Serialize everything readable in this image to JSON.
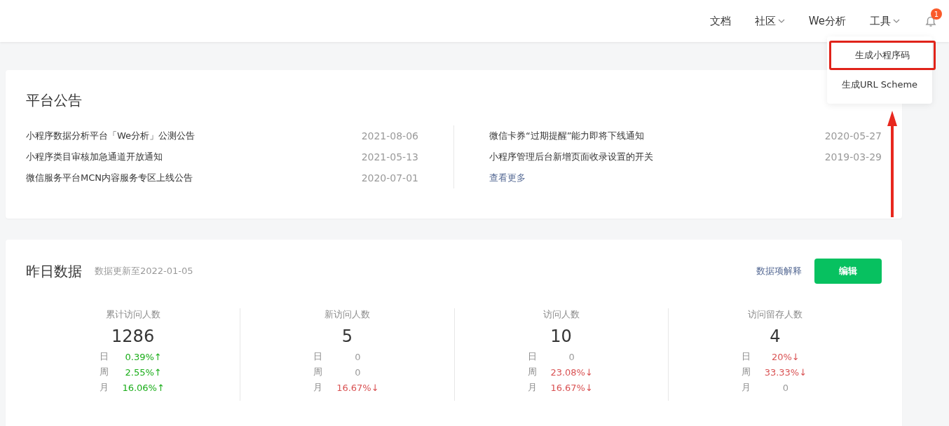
{
  "nav": [
    {
      "label": "文档",
      "dropdown": false
    },
    {
      "label": "社区",
      "dropdown": true
    },
    {
      "label": "We分析",
      "dropdown": false
    },
    {
      "label": "工具",
      "dropdown": true
    }
  ],
  "notifications": {
    "badge": "1"
  },
  "tools_menu": [
    {
      "label": "生成小程序码",
      "boxed": true
    },
    {
      "label": "生成URL Scheme",
      "boxed": false
    }
  ],
  "announcements": {
    "title": "平台公告",
    "left": [
      {
        "text": "小程序数据分析平台「We分析」公测公告",
        "date": "2021-08-06"
      },
      {
        "text": "小程序类目审核加急通道开放通知",
        "date": "2021-05-13"
      },
      {
        "text": "微信服务平台MCN内容服务专区上线公告",
        "date": "2020-07-01"
      }
    ],
    "right": [
      {
        "text": "微信卡券“过期提醒”能力即将下线通知",
        "date": "2020-05-27"
      },
      {
        "text": "小程序管理后台新增页面收录设置的开关",
        "date": "2019-03-29"
      }
    ],
    "more": "查看更多"
  },
  "yesterday": {
    "title": "昨日数据",
    "updated": "数据更新至2022-01-05",
    "explain": "数据项解释",
    "edit": "编辑",
    "stats": [
      {
        "label": "累计访问人数",
        "value": "1286",
        "rows": [
          {
            "period": "日",
            "change": "0.39%↑",
            "up": true,
            "down": false
          },
          {
            "period": "周",
            "change": "2.55%↑",
            "up": true,
            "down": false
          },
          {
            "period": "月",
            "change": "16.06%↑",
            "up": true,
            "down": false
          }
        ]
      },
      {
        "label": "新访问人数",
        "value": "5",
        "rows": [
          {
            "period": "日",
            "change": "0",
            "up": false,
            "down": false
          },
          {
            "period": "周",
            "change": "0",
            "up": false,
            "down": false
          },
          {
            "period": "月",
            "change": "16.67%↓",
            "up": false,
            "down": true
          }
        ]
      },
      {
        "label": "访问人数",
        "value": "10",
        "rows": [
          {
            "period": "日",
            "change": "0",
            "up": false,
            "down": false
          },
          {
            "period": "周",
            "change": "23.08%↓",
            "up": false,
            "down": true
          },
          {
            "period": "月",
            "change": "16.67%↓",
            "up": false,
            "down": true
          }
        ]
      },
      {
        "label": "访问留存人数",
        "value": "4",
        "rows": [
          {
            "period": "日",
            "change": "20%↓",
            "up": false,
            "down": true
          },
          {
            "period": "周",
            "change": "33.33%↓",
            "up": false,
            "down": true
          },
          {
            "period": "月",
            "change": "0",
            "up": false,
            "down": false
          }
        ]
      }
    ]
  }
}
